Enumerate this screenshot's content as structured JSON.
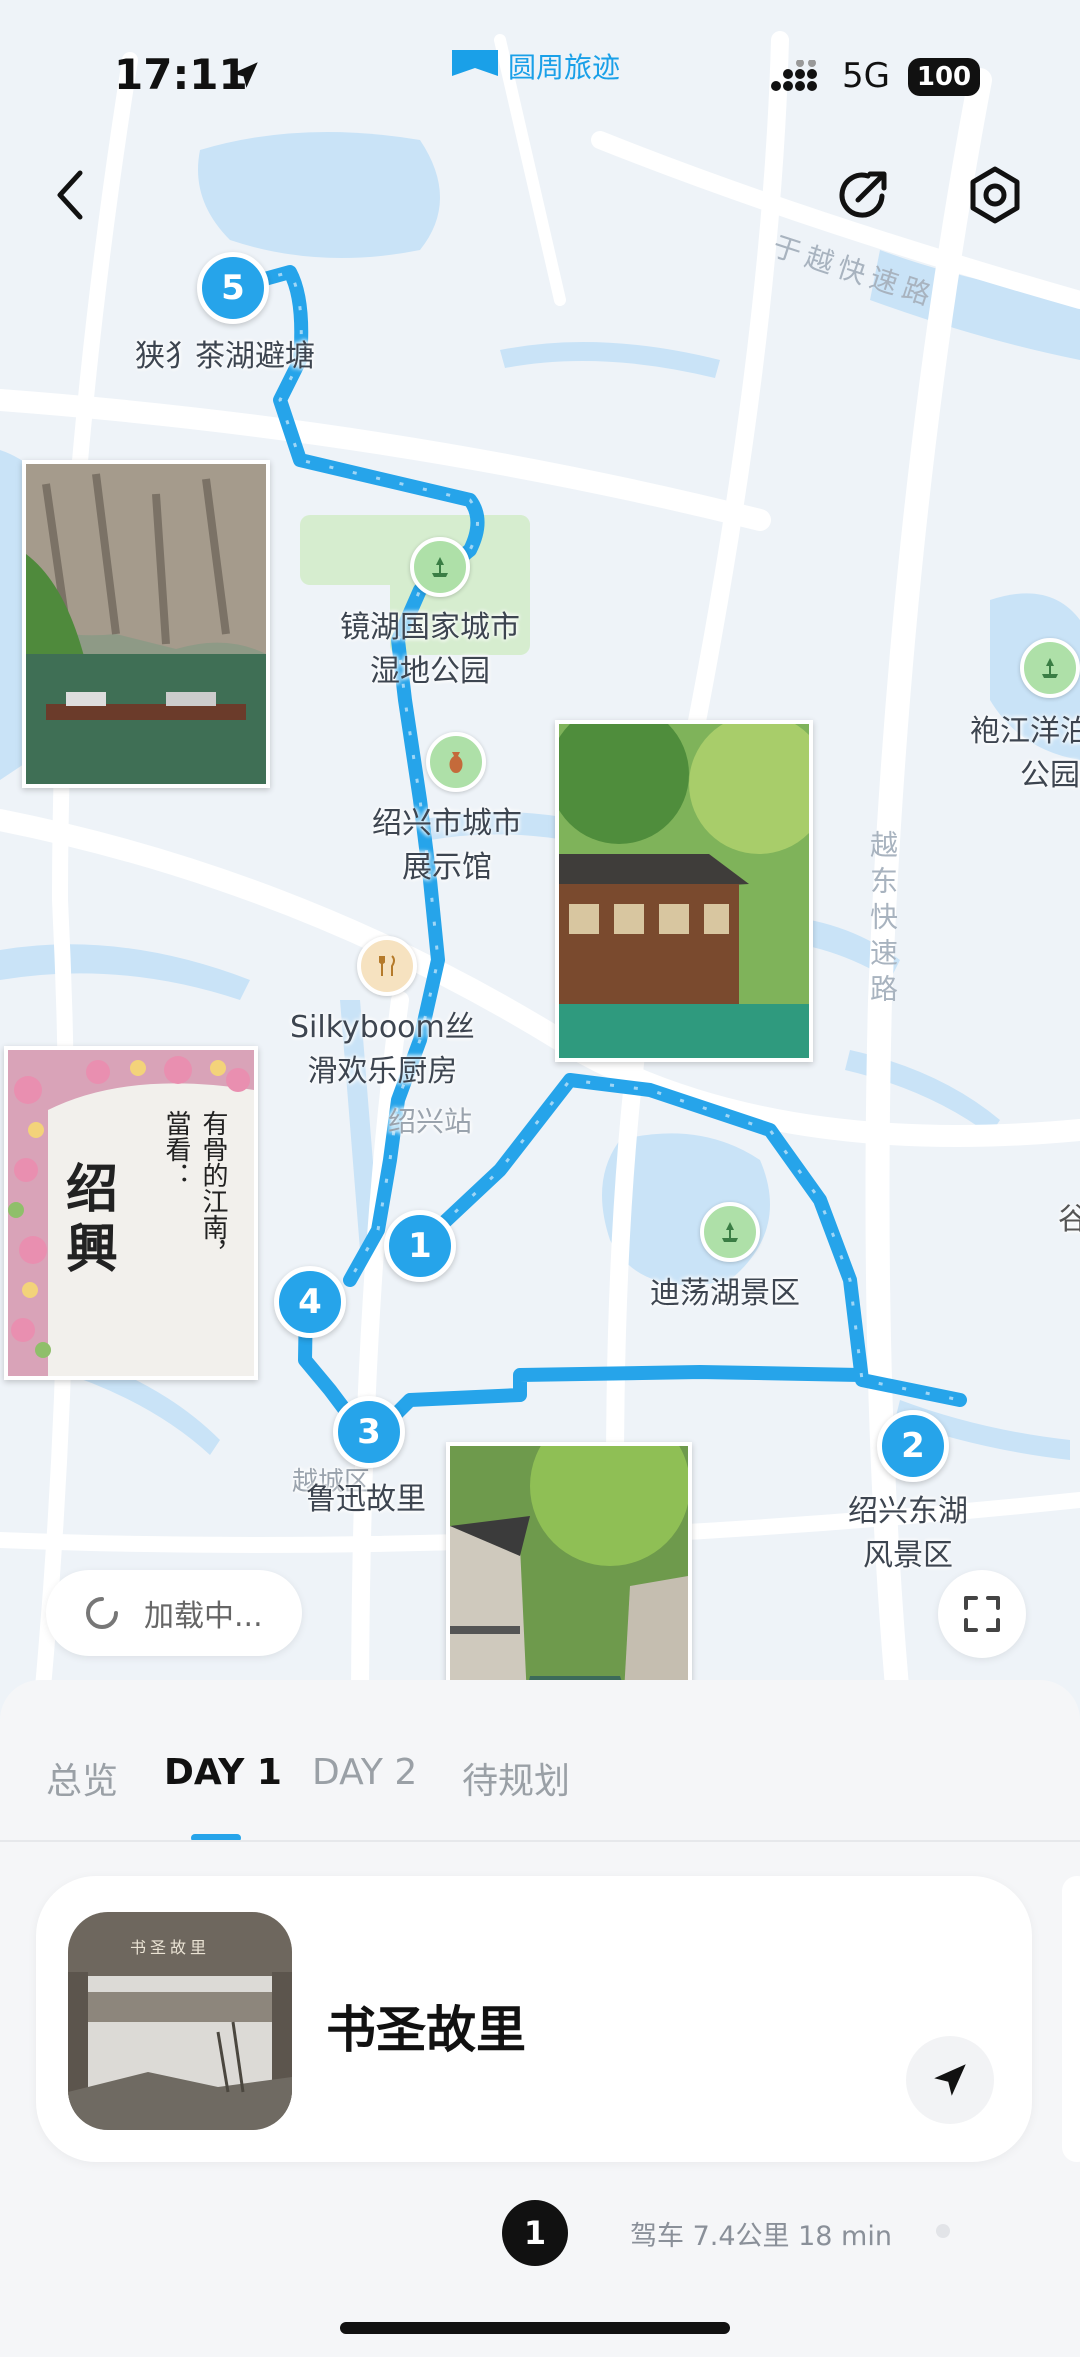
{
  "status_bar": {
    "time": "17:11",
    "brand_text": "圆周旅迹",
    "network": "5G",
    "battery": "100"
  },
  "map": {
    "stops": [
      "1",
      "2",
      "3",
      "4",
      "5"
    ],
    "labels": {
      "stop5": "狭犭茶湖避塘",
      "jinghu": "镜湖国家城市\n湿地公园",
      "museum": "绍兴市城市\n展示馆",
      "silkyboom": "Silkyboom丝\n滑欢乐厨房",
      "station": "绍兴站",
      "didang": "迪荡湖景区",
      "paojiang": "袍江洋泊\n公园",
      "luxun": "鲁迅故里",
      "district": "越城区",
      "donghu": "绍兴东湖\n风景区",
      "gu": "谷"
    },
    "roads": {
      "yuyue": "于越快速路",
      "yuedong": "越东快速路"
    },
    "loading_text": "加载中...",
    "photo_text_shaoxing": "绍興",
    "photo_text_poem": "有骨的江南，\n當看："
  },
  "tabs": [
    "总览",
    "DAY 1",
    "DAY 2",
    "待规划"
  ],
  "active_tab": "DAY 1",
  "card": {
    "title": "书圣故里",
    "thumb_sign": "书圣故里"
  },
  "route_bar": {
    "step": "1",
    "info": "驾车 7.4公里 18 min"
  },
  "colors": {
    "route": "#26a4ea",
    "accent": "#1aa0e8",
    "water": "#c9e3f7",
    "map_bg": "#eef3f8"
  },
  "icons": [
    "back-icon",
    "share-icon",
    "settings-icon",
    "location-arrow-icon",
    "fullscreen-icon",
    "navigate-icon",
    "loading-spinner-icon",
    "signal-icon",
    "battery-icon"
  ]
}
